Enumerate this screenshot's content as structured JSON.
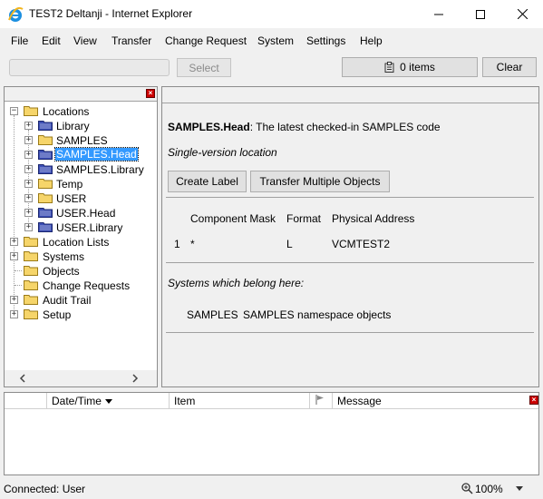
{
  "window": {
    "title": "TEST2 Deltanji - Internet Explorer"
  },
  "menu": [
    "File",
    "Edit",
    "View",
    "Transfer",
    "Change Request",
    "System",
    "Settings",
    "Help"
  ],
  "toolbar": {
    "select_label": "Select",
    "items_label": "0 items",
    "clear_label": "Clear"
  },
  "tree": {
    "root": "Locations",
    "locations": [
      "Library",
      "SAMPLES",
      "SAMPLES.Head",
      "SAMPLES.Library",
      "Temp",
      "USER",
      "USER.Head",
      "USER.Library"
    ],
    "selected": "SAMPLES.Head",
    "others": [
      "Location Lists",
      "Systems",
      "Objects",
      "Change Requests",
      "Audit Trail",
      "Setup"
    ]
  },
  "detail": {
    "name": "SAMPLES.Head",
    "description": ": The latest checked-in SAMPLES code",
    "kind": "Single-version location",
    "create_label_btn": "Create Label",
    "transfer_btn": "Transfer Multiple Objects",
    "headers": [
      "Component Mask",
      "Format",
      "Physical Address"
    ],
    "rows": [
      {
        "num": "1",
        "mask": "*",
        "format": "L",
        "address": "VCMTEST2"
      }
    ],
    "systems_heading": "Systems which belong here:",
    "systems": [
      {
        "name": "SAMPLES",
        "desc": "SAMPLES namespace objects"
      }
    ]
  },
  "log": {
    "columns": [
      "Date/Time",
      "Item",
      "Message"
    ]
  },
  "status": {
    "text": "Connected: User",
    "zoom": "100%"
  },
  "colors": {
    "selection": "#3399ff",
    "folder_yellow": "#f6d56a",
    "folder_blue": "#3d4fb5",
    "close_red": "#cc0000"
  }
}
